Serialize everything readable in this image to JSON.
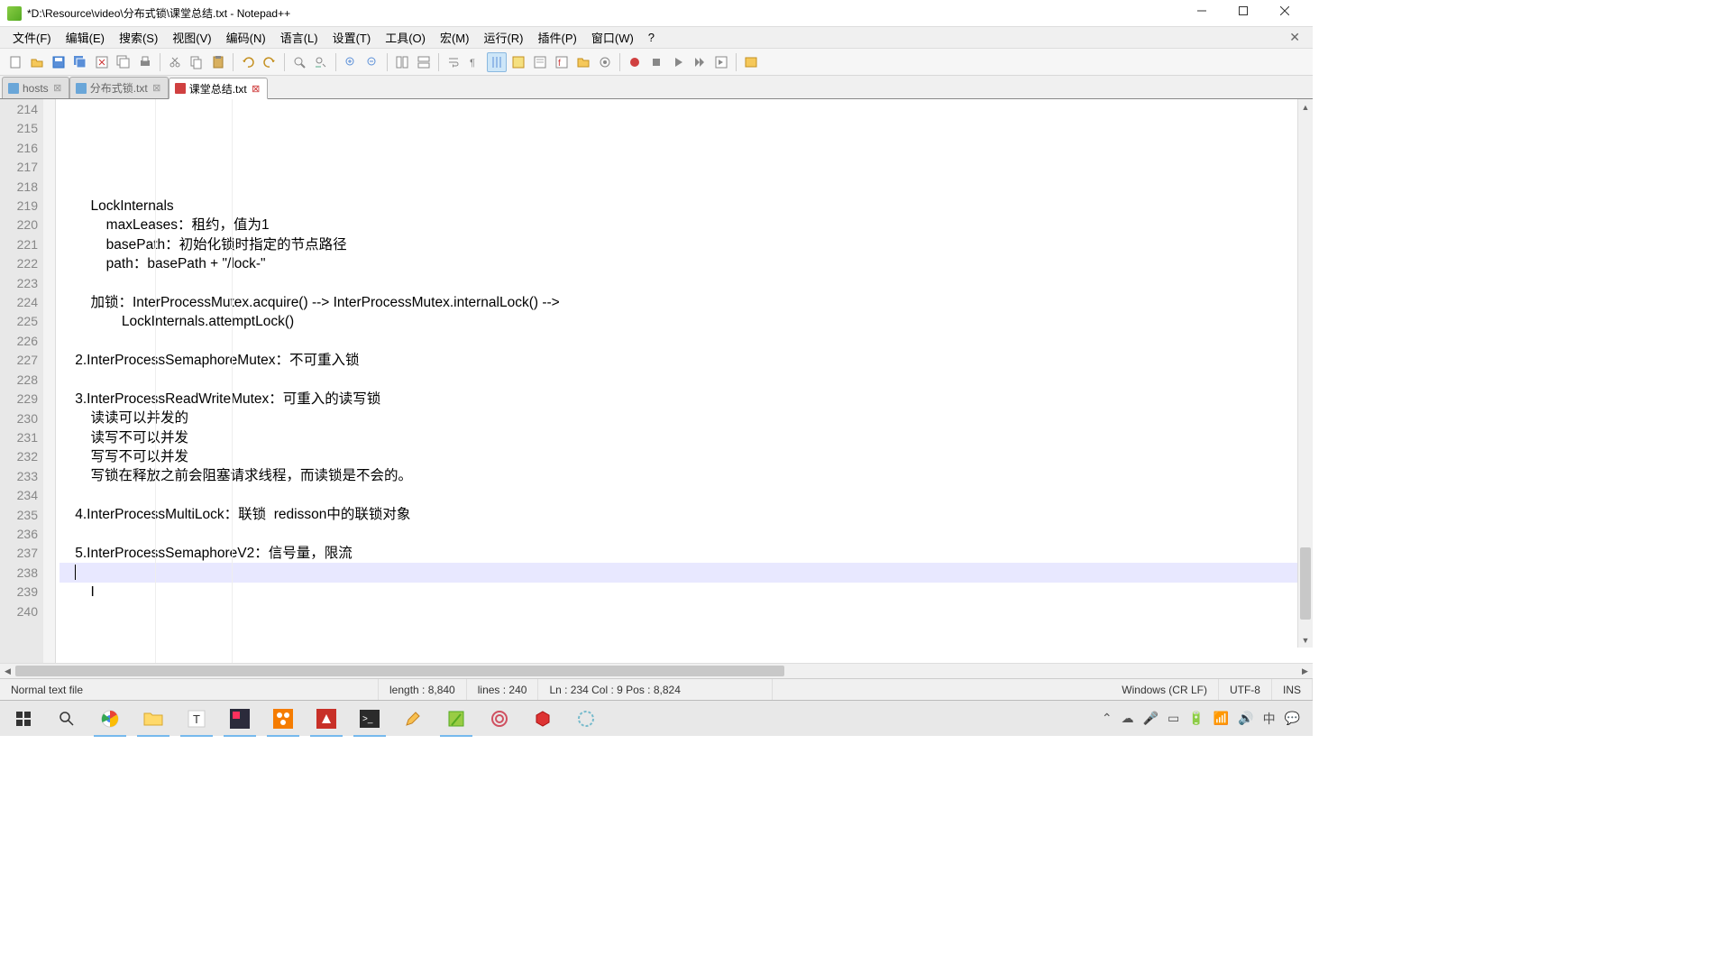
{
  "title": "*D:\\Resource\\video\\分布式锁\\课堂总结.txt - Notepad++",
  "menu": [
    "文件(F)",
    "编辑(E)",
    "搜索(S)",
    "视图(V)",
    "编码(N)",
    "语言(L)",
    "设置(T)",
    "工具(O)",
    "宏(M)",
    "运行(R)",
    "插件(P)",
    "窗口(W)",
    "?"
  ],
  "tabs": [
    {
      "label": "hosts",
      "saved": true,
      "active": false
    },
    {
      "label": "分布式锁.txt",
      "saved": true,
      "active": false
    },
    {
      "label": "课堂总结.txt",
      "saved": false,
      "active": true
    }
  ],
  "first_line_no": 214,
  "current_line_index": 20,
  "lines": [
    "",
    "        LockInternals",
    "            maxLeases：租约，值为1",
    "            basePath：初始化锁时指定的节点路径",
    "            path：basePath + \"/lock-\"",
    "",
    "        加锁：InterProcessMutex.acquire() --> InterProcessMutex.internalLock() -->",
    "                LockInternals.attemptLock()",
    "",
    "    2.InterProcessSemaphoreMutex：不可重入锁",
    "",
    "    3.InterProcessReadWriteMutex：可重入的读写锁",
    "        读读可以并发的",
    "        读写不可以并发",
    "        写写不可以并发",
    "        写锁在释放之前会阻塞请求线程，而读锁是不会的。",
    "",
    "    4.InterProcessMultiLock：联锁  redisson中的联锁对象",
    "",
    "    5.InterProcessSemaphoreV2：信号量，限流",
    "    ",
    "        I",
    "    ",
    "",
    "",
    "",
    ""
  ],
  "status": {
    "filetype": "Normal text file",
    "length": "length : 8,840",
    "lines": "lines : 240",
    "pos": "Ln : 234    Col : 9    Pos : 8,824",
    "eol": "Windows (CR LF)",
    "enc": "UTF-8",
    "ins": "INS"
  }
}
